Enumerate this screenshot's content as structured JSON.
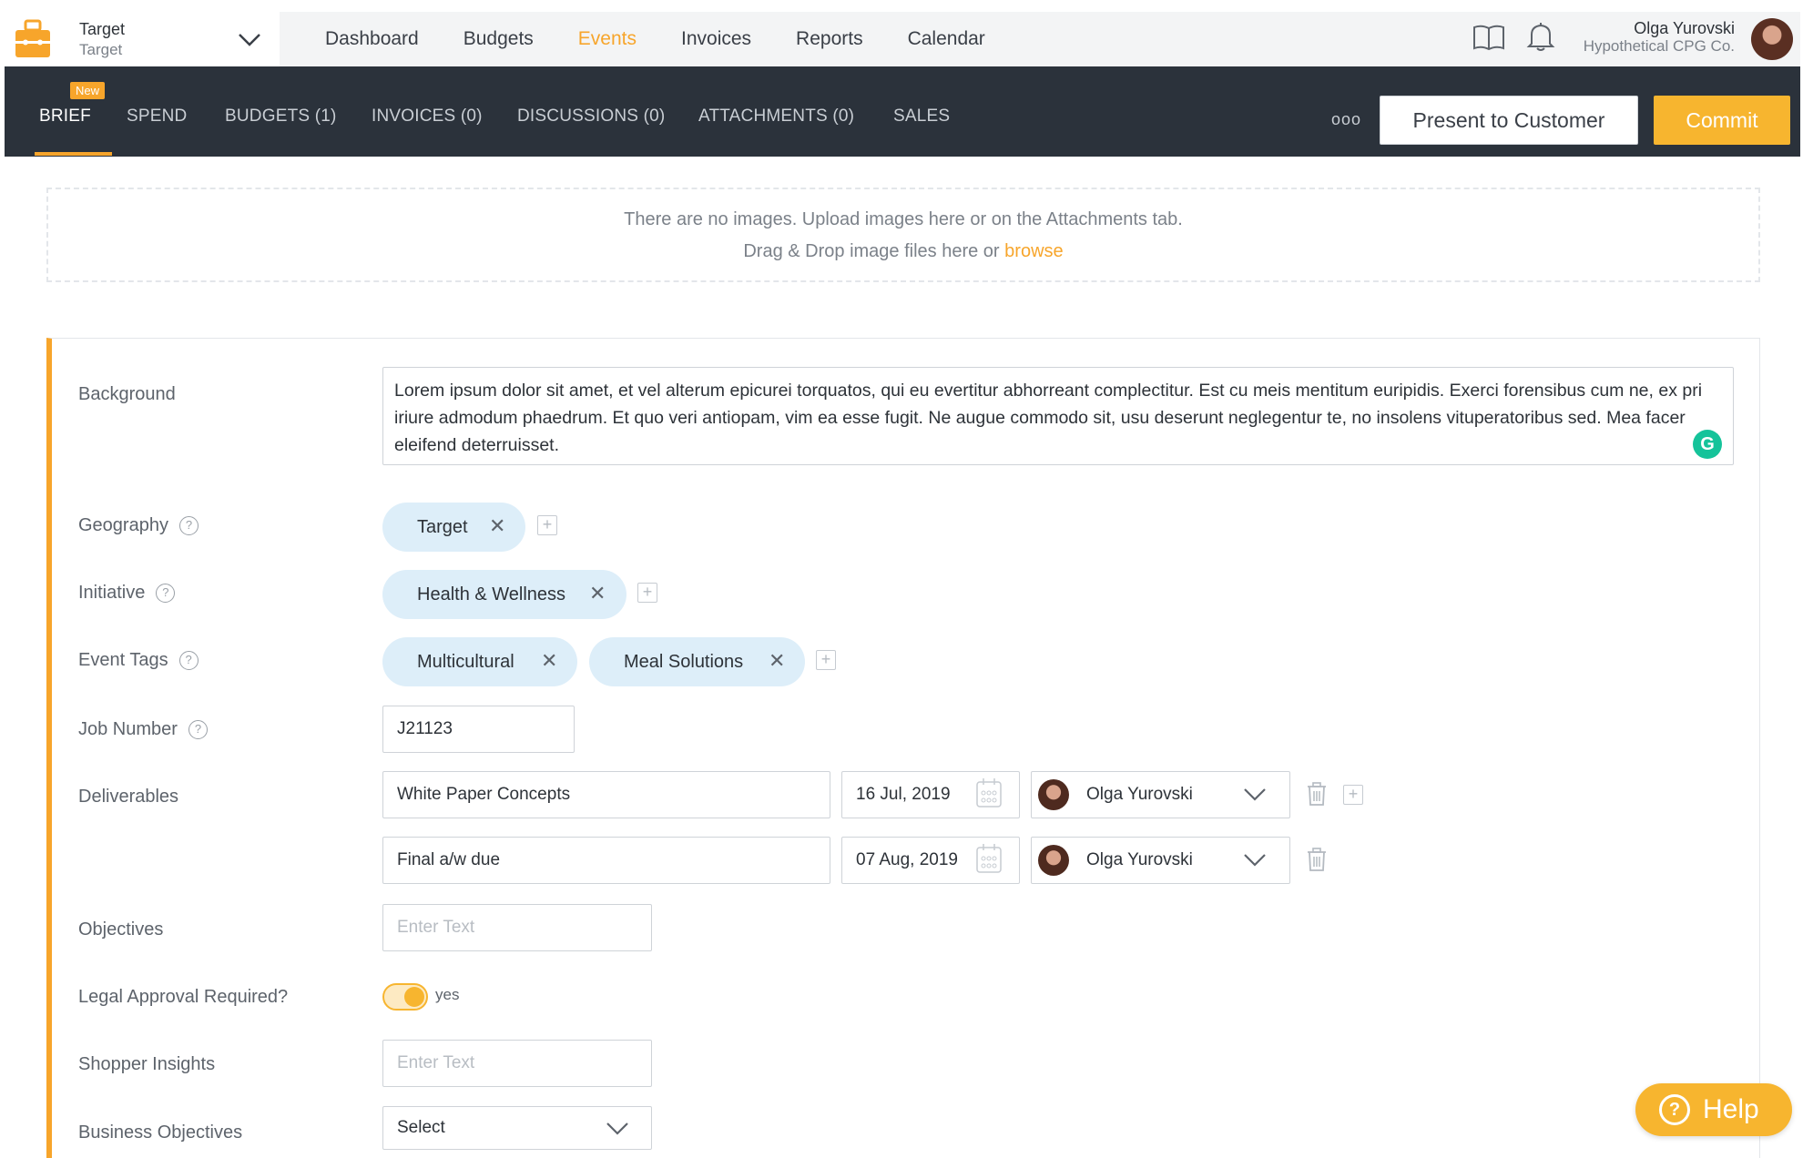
{
  "account": {
    "name": "Target",
    "sub": "Target"
  },
  "main_nav": [
    "Dashboard",
    "Budgets",
    "Events",
    "Invoices",
    "Reports",
    "Calendar"
  ],
  "active_nav": "Events",
  "user": {
    "name": "Olga Yurovski",
    "org": "Hypothetical CPG Co."
  },
  "sub_tabs": {
    "brief": "BRIEF",
    "spend": "SPEND",
    "budgets": "BUDGETS (1)",
    "invoices": "INVOICES (0)",
    "discussions": "DISCUSSIONS (0)",
    "attachments": "ATTACHMENTS (0)",
    "sales": "SALES",
    "new_badge": "New",
    "more": "ooo"
  },
  "actions": {
    "present": "Present to Customer",
    "commit": "Commit"
  },
  "dropzone": {
    "line1": "There are no images. Upload images here or on the Attachments tab.",
    "line2_prefix": "Drag & Drop image files here or ",
    "browse": "browse"
  },
  "form": {
    "labels": {
      "background": "Background",
      "geography": "Geography",
      "initiative": "Initiative",
      "event_tags": "Event Tags",
      "job_number": "Job Number",
      "deliverables": "Deliverables",
      "objectives": "Objectives",
      "legal": "Legal Approval Required?",
      "shopper": "Shopper Insights",
      "business": "Business Objectives"
    },
    "background_text": "Lorem ipsum dolor sit amet, et vel alterum epicurei torquatos, qui eu evertitur abhorreant complectitur. Est cu meis mentitum euripidis. Exerci forensibus cum ne, ex pri iriure admodum phaedrum. Et quo veri antiopam, vim ea esse fugit. Ne augue commodo sit, usu deserunt neglegentur te, no insolens vituperatoribus sed. Mea facer eleifend deterruisset.",
    "geography_tags": [
      "Target"
    ],
    "initiative_tags": [
      "Health & Wellness"
    ],
    "event_tags": [
      "Multicultural",
      "Meal Solutions"
    ],
    "job_number": "J21123",
    "deliverables": [
      {
        "name": "White Paper Concepts",
        "date": "16 Jul, 2019",
        "owner": "Olga Yurovski"
      },
      {
        "name": "Final a/w due",
        "date": "07 Aug, 2019",
        "owner": "Olga Yurovski"
      }
    ],
    "objectives_placeholder": "Enter Text",
    "legal_value": "yes",
    "shopper_placeholder": "Enter Text",
    "business_select": "Select",
    "qmark": "?",
    "remove_glyph": "✕",
    "add_glyph": "+"
  },
  "grammarly_glyph": "G",
  "help": {
    "label": "Help",
    "glyph": "?"
  },
  "colors": {
    "accent": "#f7a52b",
    "dark_bar": "#2b323b",
    "chip": "#ddeef9"
  }
}
